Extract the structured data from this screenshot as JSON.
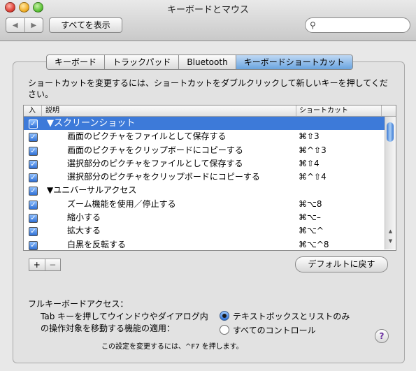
{
  "window": {
    "title": "キーボードとマウス"
  },
  "toolbar": {
    "show_all": "すべてを表示",
    "back": "◀",
    "forward": "▶",
    "search_placeholder": ""
  },
  "tabs": [
    {
      "label": "キーボード",
      "active": false
    },
    {
      "label": "トラックパッド",
      "active": false
    },
    {
      "label": "Bluetooth",
      "active": false
    },
    {
      "label": "キーボードショートカット",
      "active": true
    }
  ],
  "instructions": "ショートカットを変更するには、ショートカットをダブルクリックして新しいキーを押してください。",
  "table": {
    "headers": {
      "enabled": "入",
      "description": "説明",
      "shortcut": "ショートカット"
    },
    "rows": [
      {
        "enabled": true,
        "description": "▼スクリーンショット",
        "shortcut": "",
        "group": true,
        "selected": true
      },
      {
        "enabled": true,
        "description": "画面のピクチャをファイルとして保存する",
        "shortcut": "⌘⇧3",
        "group": false,
        "selected": false
      },
      {
        "enabled": true,
        "description": "画面のピクチャをクリップボードにコピーする",
        "shortcut": "⌘^⇧3",
        "group": false,
        "selected": false
      },
      {
        "enabled": true,
        "description": "選択部分のピクチャをファイルとして保存する",
        "shortcut": "⌘⇧4",
        "group": false,
        "selected": false
      },
      {
        "enabled": true,
        "description": "選択部分のピクチャをクリップボードにコピーする",
        "shortcut": "⌘^⇧4",
        "group": false,
        "selected": false
      },
      {
        "enabled": true,
        "description": "▼ユニバーサルアクセス",
        "shortcut": "",
        "group": true,
        "selected": false
      },
      {
        "enabled": true,
        "description": "ズーム機能を使用／停止する",
        "shortcut": "⌘⌥8",
        "group": false,
        "selected": false
      },
      {
        "enabled": true,
        "description": "縮小する",
        "shortcut": "⌘⌥–",
        "group": false,
        "selected": false
      },
      {
        "enabled": true,
        "description": "拡大する",
        "shortcut": "⌘⌥^",
        "group": false,
        "selected": false
      },
      {
        "enabled": true,
        "description": "白黒を反転する",
        "shortcut": "⌘⌥^8",
        "group": false,
        "selected": false
      }
    ]
  },
  "list_buttons": {
    "add": "+",
    "remove": "−"
  },
  "default_button": "デフォルトに戻す",
  "full_keyboard_access": {
    "label": "フルキーボードアクセス：",
    "description": "Tab キーを押してウインドウやダイアログ内の操作対象を移動する機能の適用：",
    "options": [
      {
        "label": "テキストボックスとリストのみ",
        "selected": true
      },
      {
        "label": "すべてのコントロール",
        "selected": false
      }
    ],
    "note": "この設定を変更するには、^F7 を押します。"
  },
  "help": "?"
}
